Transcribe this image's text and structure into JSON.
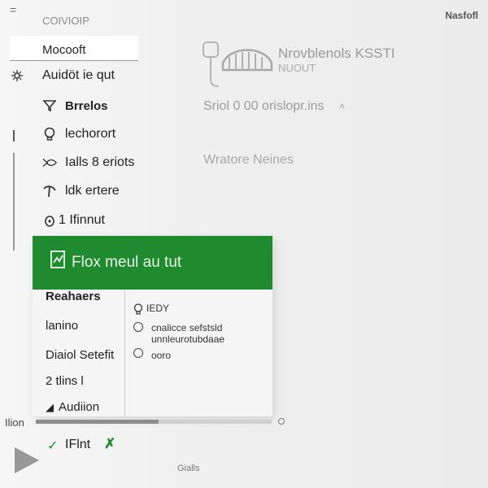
{
  "topbar": {
    "menu_glyph": "=",
    "crumb": "COIVIOIP",
    "right_title": "Nasfofl"
  },
  "sidebar": {
    "header_label": "Mocooft",
    "items": [
      {
        "label": "Auidöt ie qut",
        "icon": "settings-gear-icon"
      },
      {
        "label": "Brrelos",
        "icon": "filter-funnel-icon",
        "bold": true
      },
      {
        "label": "lechorort",
        "icon": "lightbulb-icon"
      },
      {
        "label": "Ialls 8 eriots",
        "icon": "fish-icon"
      },
      {
        "label": "ldk ertere",
        "icon": "pin-icon"
      },
      {
        "label": "1 Ifinnut",
        "icon": "shield-icon"
      }
    ]
  },
  "main": {
    "title": "Nrovblenols KSSTI",
    "subtitle": "NUOUT",
    "stats": "Sriol 0 00 orislopr.ins",
    "stats_arrow": "˄",
    "section": "Wratore Neines"
  },
  "dropdown": {
    "header_label": "Flox meul au tut",
    "header_bg": "#1f8a2e",
    "left_items": [
      {
        "label": "Reahaers",
        "bold": true
      },
      {
        "label": "lanino",
        "bold": false
      },
      {
        "label": "Diaiol Setefit",
        "bold": false
      },
      {
        "label": "2 tlins l",
        "bold": false
      },
      {
        "label": "Audiion",
        "bold": false
      }
    ],
    "right_items": [
      {
        "label": "IEDY",
        "icon": "lightbulb-icon"
      },
      {
        "label": "cnalicce sefstsld unnleurotubdaae",
        "icon": "radio-icon"
      },
      {
        "label": "ooro",
        "icon": "radio-icon"
      }
    ]
  },
  "progress": {
    "label": "Ilion",
    "value": 0.52
  },
  "bottom": {
    "label": "IFlnt",
    "center_text": "Gialls"
  }
}
